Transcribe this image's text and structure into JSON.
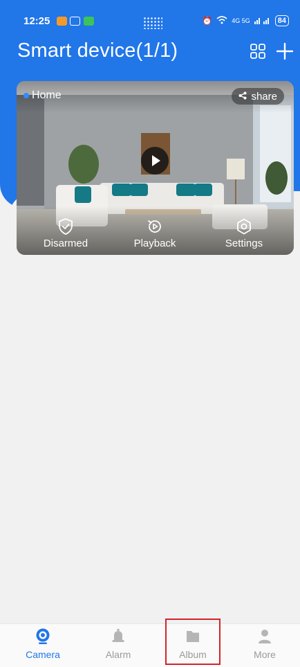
{
  "colors": {
    "brand_blue": "#2176e8",
    "background": "#f1f1f1",
    "highlight_red": "#d2232a",
    "inactive_gray": "#9a9a9a"
  },
  "status_bar": {
    "time": "12:25",
    "network": "4G 5G",
    "battery": "84"
  },
  "header": {
    "title": "Smart device(1/1)"
  },
  "device_card": {
    "location_label": "Home",
    "share_label": "share",
    "actions": [
      {
        "label": "Disarmed",
        "icon": "shield-check-icon"
      },
      {
        "label": "Playback",
        "icon": "playback-icon"
      },
      {
        "label": "Settings",
        "icon": "settings-icon"
      }
    ]
  },
  "bottom_nav": {
    "items": [
      {
        "label": "Camera",
        "icon": "camera-icon",
        "active": true
      },
      {
        "label": "Alarm",
        "icon": "bell-icon",
        "active": false
      },
      {
        "label": "Album",
        "icon": "folder-icon",
        "active": false
      },
      {
        "label": "More",
        "icon": "person-icon",
        "active": false
      }
    ]
  }
}
